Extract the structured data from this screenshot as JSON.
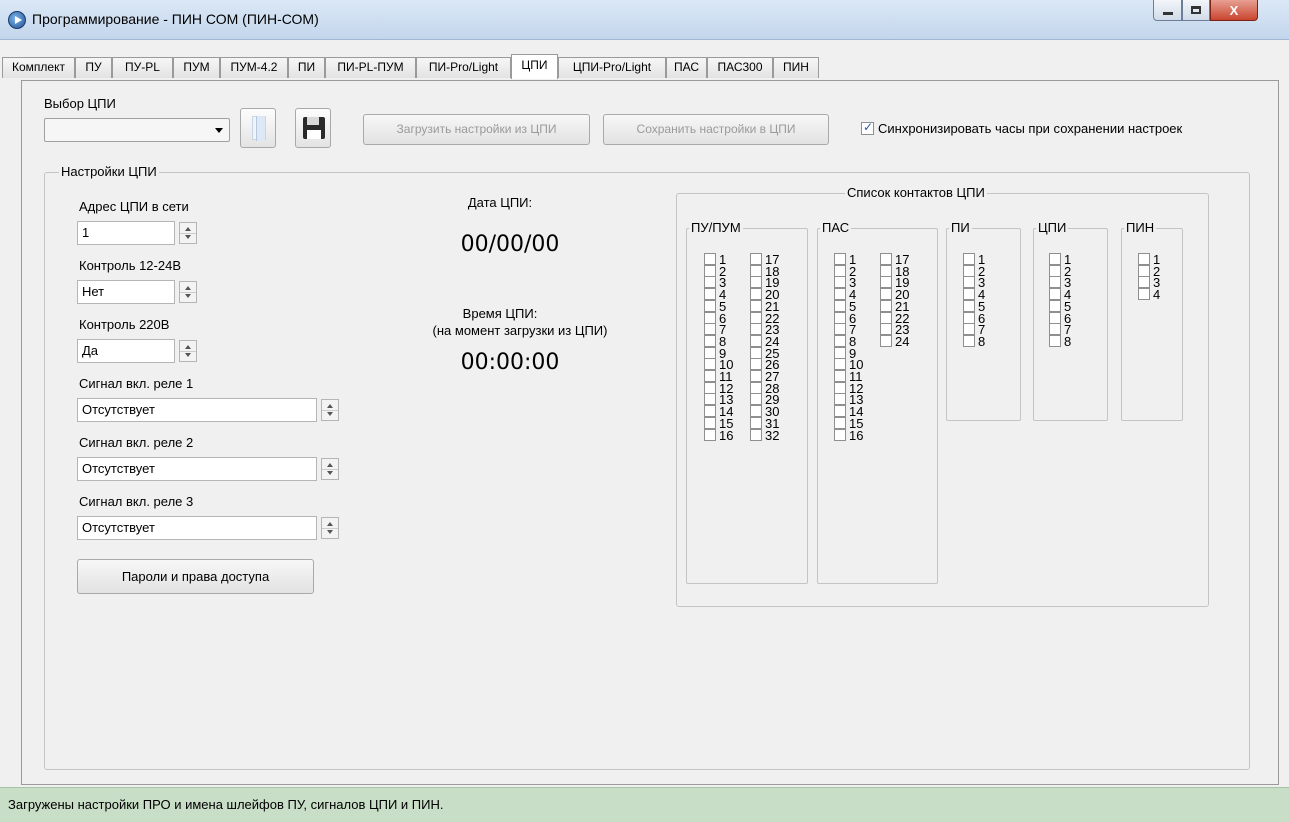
{
  "window": {
    "title": "Программирование - ПИН СОМ (ПИН-СОМ)",
    "close_glyph": "X"
  },
  "tabs": [
    {
      "label": "Комплект"
    },
    {
      "label": "ПУ"
    },
    {
      "label": "ПУ-PL"
    },
    {
      "label": "ПУМ"
    },
    {
      "label": "ПУМ-4.2"
    },
    {
      "label": "ПИ"
    },
    {
      "label": "ПИ-PL-ПУМ"
    },
    {
      "label": "ПИ-Pro/Light"
    },
    {
      "label": "ЦПИ",
      "active": true
    },
    {
      "label": "ЦПИ-Pro/Light"
    },
    {
      "label": "ПАС"
    },
    {
      "label": "ПАС300"
    },
    {
      "label": "ПИН"
    }
  ],
  "toolbar": {
    "select_label": "Выбор ЦПИ",
    "select_value": "",
    "load_label": "Загрузить настройки из ЦПИ",
    "save_label": "Сохранить настройки в ЦПИ",
    "sync_label": "Синхронизировать часы при сохранении настроек",
    "sync_checked": true
  },
  "settings": {
    "group_title": "Настройки ЦПИ",
    "address_label": "Адрес ЦПИ в сети",
    "address_value": "1",
    "control_1224_label": "Контроль 12-24В",
    "control_1224_value": "Нет",
    "control_220_label": "Контроль 220В",
    "control_220_value": "Да",
    "relay1_label": "Сигнал вкл. реле 1",
    "relay1_value": "Отсутствует",
    "relay2_label": "Сигнал вкл. реле 2",
    "relay2_value": "Отсутствует",
    "relay3_label": "Сигнал вкл. реле 3",
    "relay3_value": "Отсутствует",
    "passwords_button": "Пароли и права доступа"
  },
  "clock": {
    "date_label": "Дата ЦПИ:",
    "date_value": "00/00/00",
    "time_label": "Время ЦПИ:",
    "time_note": "(на момент загрузки из ЦПИ)",
    "time_value": "00:00:00"
  },
  "contacts": {
    "title": "Список контактов ЦПИ",
    "groups": [
      {
        "name": "ПУ/ПУМ",
        "count": 32
      },
      {
        "name": "ПАС",
        "count": 24
      },
      {
        "name": "ПИ",
        "count": 8
      },
      {
        "name": "ЦПИ",
        "count": 8
      },
      {
        "name": "ПИН",
        "count": 4
      }
    ]
  },
  "status": {
    "text": "Загружены настройки ПРО и имена шлейфов ПУ, сигналов ЦПИ и ПИН."
  }
}
